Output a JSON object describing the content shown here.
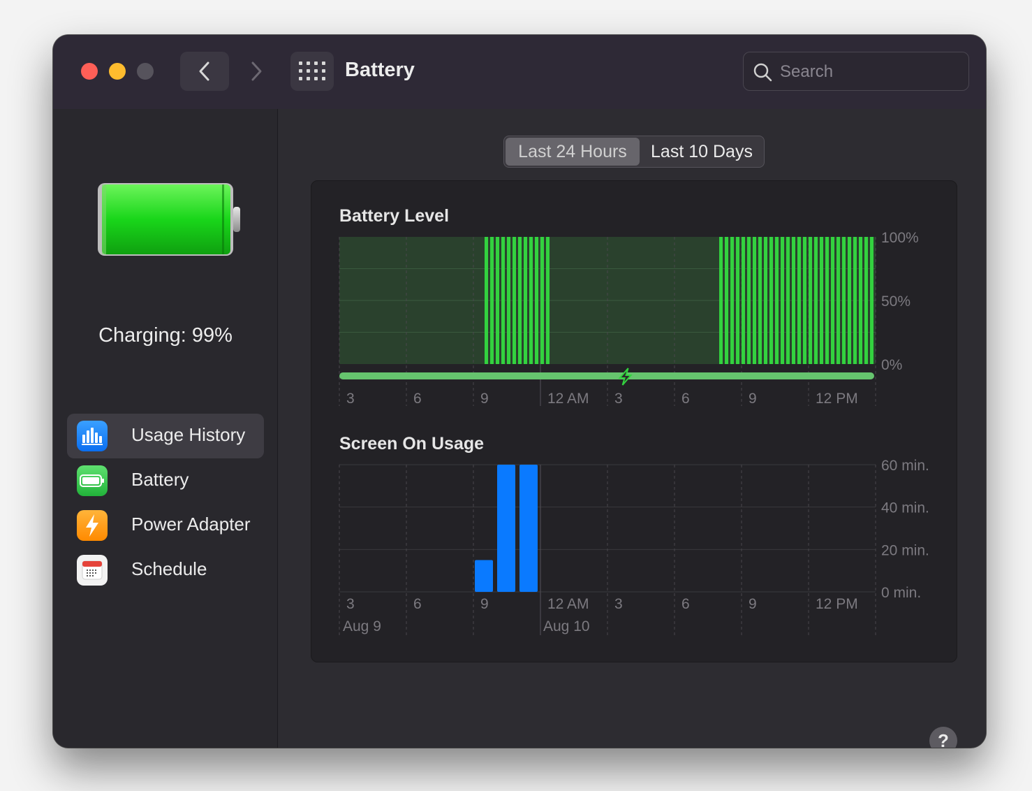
{
  "window": {
    "title": "Battery"
  },
  "search": {
    "placeholder": "Search"
  },
  "sidebar": {
    "status": "Charging: 99%",
    "items": [
      {
        "label": "Usage History",
        "icon": "bar-chart-icon",
        "selected": true,
        "color": "#1a82fb"
      },
      {
        "label": "Battery",
        "icon": "battery-icon",
        "selected": false,
        "color": "#34c759"
      },
      {
        "label": "Power Adapter",
        "icon": "lightning-icon",
        "selected": false,
        "color": "#ff9f0a"
      },
      {
        "label": "Schedule",
        "icon": "calendar-icon",
        "selected": false,
        "color": "#f2f2f2"
      }
    ]
  },
  "tabs": {
    "active": "Last 24 Hours",
    "inactive": "Last 10 Days"
  },
  "charts": {
    "battery_title": "Battery Level",
    "screen_title": "Screen On Usage"
  },
  "chart_data": [
    {
      "type": "bar",
      "title": "Battery Level",
      "x": [
        "3",
        "6",
        "9",
        "12 AM",
        "3",
        "6",
        "9",
        "12 PM"
      ],
      "y_ticks": [
        "100%",
        "50%",
        "0%"
      ],
      "ylim": [
        0,
        100
      ],
      "color": "#33d23f",
      "segments": [
        {
          "from_hour": 9.5,
          "to_hour": 12.4,
          "level": 100
        },
        {
          "from_hour": 20.0,
          "to_hour": 27.0,
          "level": 100
        }
      ],
      "charging_indicator": "full period",
      "charging_icon_hour": 15.8,
      "grid": true
    },
    {
      "type": "bar",
      "title": "Screen On Usage",
      "x": [
        "3",
        "6",
        "9",
        "12 AM",
        "3",
        "6",
        "9",
        "12 PM"
      ],
      "date_labels": [
        "Aug 9",
        "Aug 10"
      ],
      "y_ticks": [
        "60 min.",
        "40 min.",
        "20 min.",
        "0 min."
      ],
      "ylim": [
        0,
        60
      ],
      "color": "#0a7aff",
      "bars": [
        {
          "hour": 9,
          "value": 15
        },
        {
          "hour": 10,
          "value": 60
        },
        {
          "hour": 11,
          "value": 60
        }
      ],
      "grid": true
    }
  ],
  "help": {
    "label": "?"
  }
}
